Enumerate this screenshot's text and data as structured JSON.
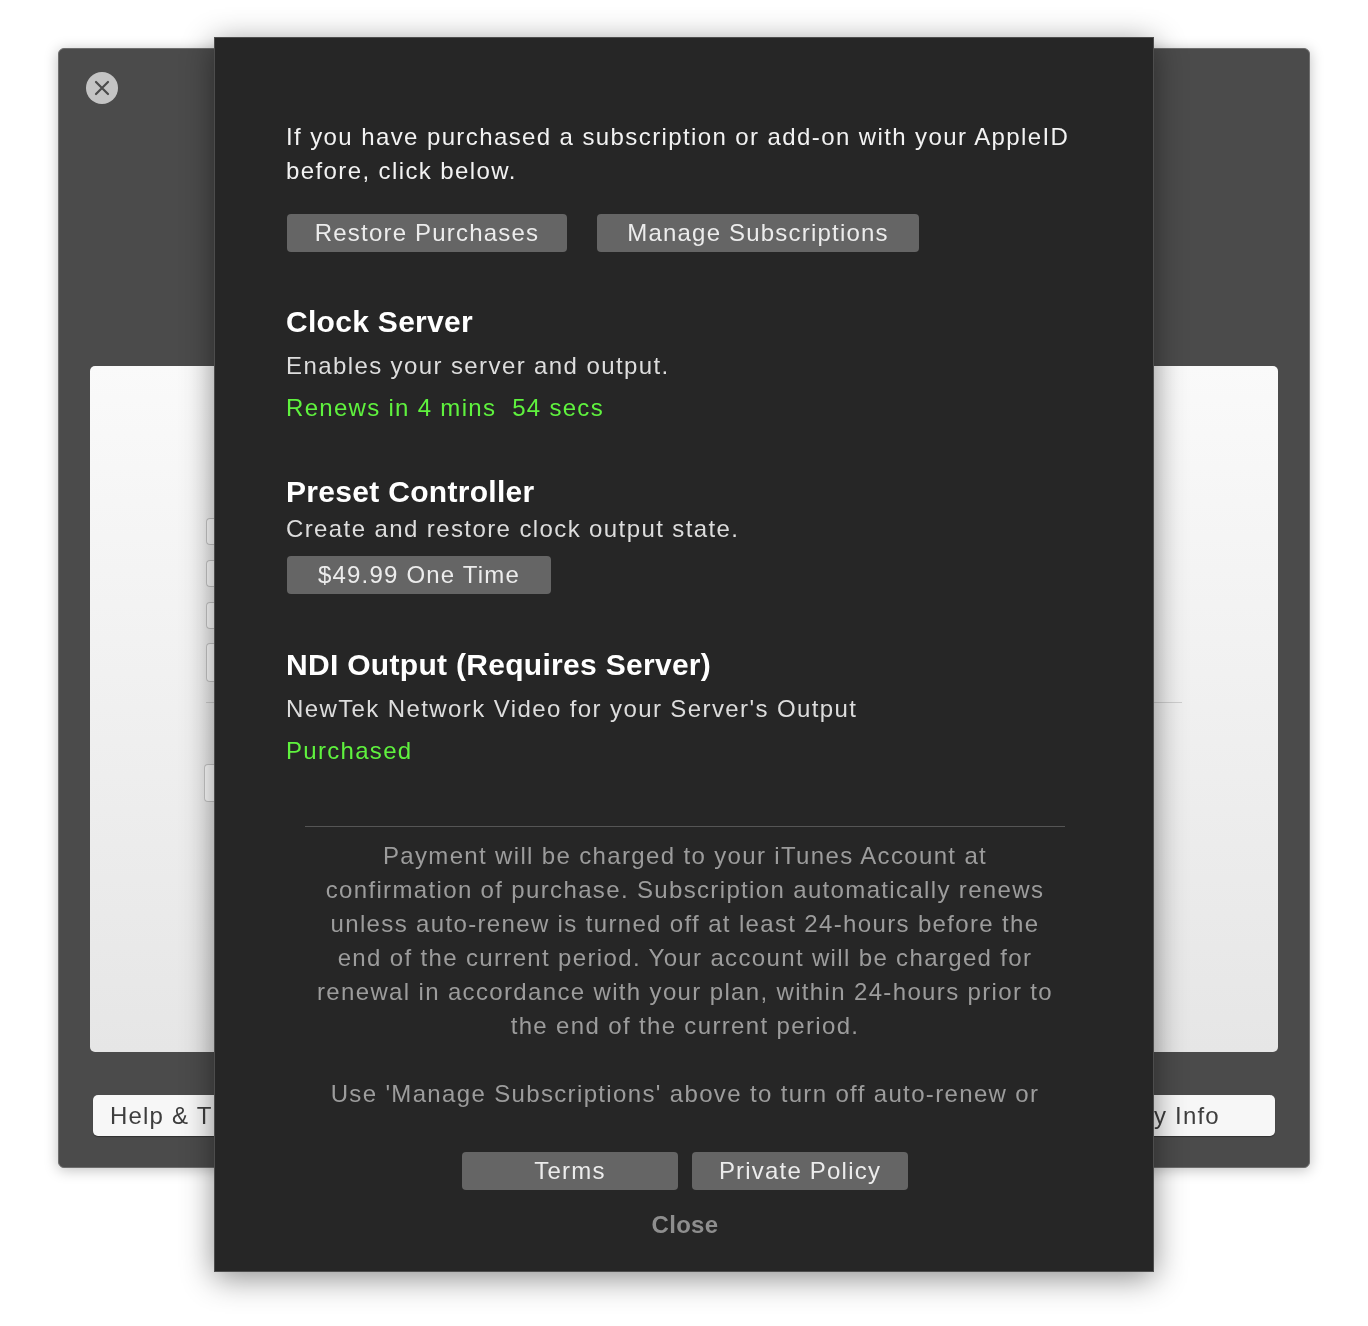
{
  "window": {
    "buttons": [
      "Help & T",
      "y Info"
    ]
  },
  "sheet": {
    "intro": "If you have purchased a subscription or add-on with your AppleID before, click below.",
    "top_buttons": [
      "Restore Purchases",
      "Manage Subscriptions"
    ],
    "products": [
      {
        "title": "Clock Server",
        "description": "Enables your server and output.",
        "kind": "status",
        "status": "Renews in 4 mins  54 secs"
      },
      {
        "title": "Preset Controller",
        "description": "Create and restore clock output state.",
        "kind": "button",
        "button": "$49.99 One Time"
      },
      {
        "title": "NDI Output (Requires Server)",
        "description": "NewTek Network Video for your Server's Output",
        "kind": "status",
        "status": "Purchased"
      }
    ],
    "legal": [
      "Payment will be charged to your iTunes Account at confirmation of purchase. Subscription automatically renews unless auto-renew is turned off at least 24-hours before the end of the current period. Your account will be charged for renewal in accordance with your plan, within 24-hours prior to the end of the current period.",
      "Use 'Manage Subscriptions' above to turn off auto-renew or"
    ],
    "bottom_buttons": [
      "Terms",
      "Private Policy"
    ],
    "close": "Close"
  }
}
